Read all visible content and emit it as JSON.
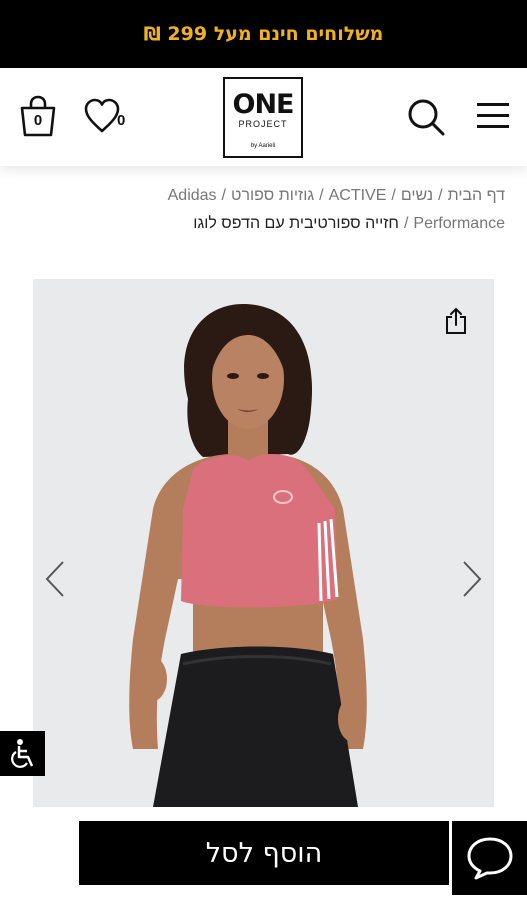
{
  "promo": {
    "text": "משלוחים חינם מעל 299 ₪",
    "color": "#f2b21f"
  },
  "header": {
    "logo": {
      "main": "ONE",
      "sub": "PROJECT",
      "by": "by Aarieli"
    },
    "bag_count": "0",
    "wishlist_count": "0",
    "icons": [
      "menu-icon",
      "search-icon",
      "bag-icon",
      "heart-icon"
    ]
  },
  "breadcrumb": {
    "items": [
      "דף הבית",
      "נשים",
      "ACTIVE",
      "גוזיות ספורט",
      "Adidas",
      "Performance"
    ],
    "separator": "/",
    "current": "חזייה ספורטיבית עם הדפס לוגו"
  },
  "product": {
    "image_bg": "#e8eaeb",
    "top_color": "#d9707b",
    "pants_color": "#1c1c1e"
  },
  "actions": {
    "add_to_cart": "הוסף לסל",
    "icons": [
      "share-icon",
      "chevron-left-icon",
      "chevron-right-icon",
      "accessibility-icon",
      "chat-icon"
    ]
  }
}
